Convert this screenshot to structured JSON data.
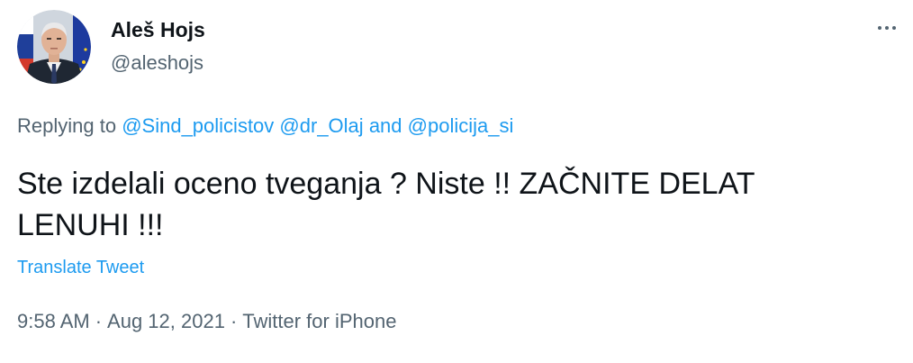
{
  "author": {
    "display_name": "Aleš Hojs",
    "handle": "@aleshojs"
  },
  "reply": {
    "prefix": "Replying to",
    "mention_1": "@Sind_policistov",
    "mention_2": "@dr_Olaj",
    "joiner": "and",
    "mention_3": "@policija_si"
  },
  "tweet": {
    "line_1": "Ste izdelali oceno tveganja ? Niste !! ZAČNITE DELAT",
    "line_2": "LENUHI !!!",
    "translate_label": "Translate Tweet"
  },
  "meta": {
    "time": "9:58 AM",
    "separator": "·",
    "date": "Aug 12, 2021",
    "source": "Twitter for iPhone"
  },
  "icons": {
    "more": "more-icon",
    "avatar": "avatar"
  },
  "colors": {
    "link": "#1d9bf0",
    "secondary": "#536471",
    "text": "#0f1419"
  }
}
